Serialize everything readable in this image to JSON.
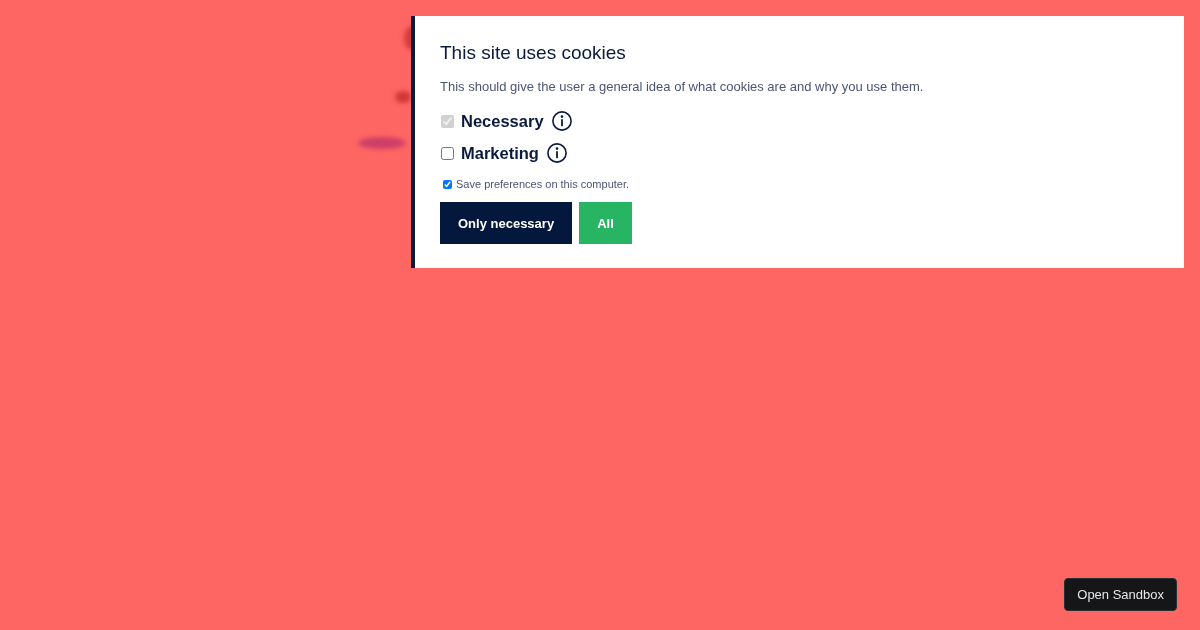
{
  "cookie_dialog": {
    "title": "This site uses cookies",
    "description": "This should give the user a general idea of what cookies are and why you use them.",
    "options": [
      {
        "label": "Necessary",
        "checked": true,
        "disabled": true
      },
      {
        "label": "Marketing",
        "checked": false,
        "disabled": false
      }
    ],
    "save_preferences": {
      "label": "Save preferences on this computer.",
      "checked": true
    },
    "buttons": [
      {
        "label": "Only necessary",
        "kind": "primary"
      },
      {
        "label": "All",
        "kind": "accept"
      }
    ]
  },
  "sandbox_button": {
    "label": "Open Sandbox"
  }
}
